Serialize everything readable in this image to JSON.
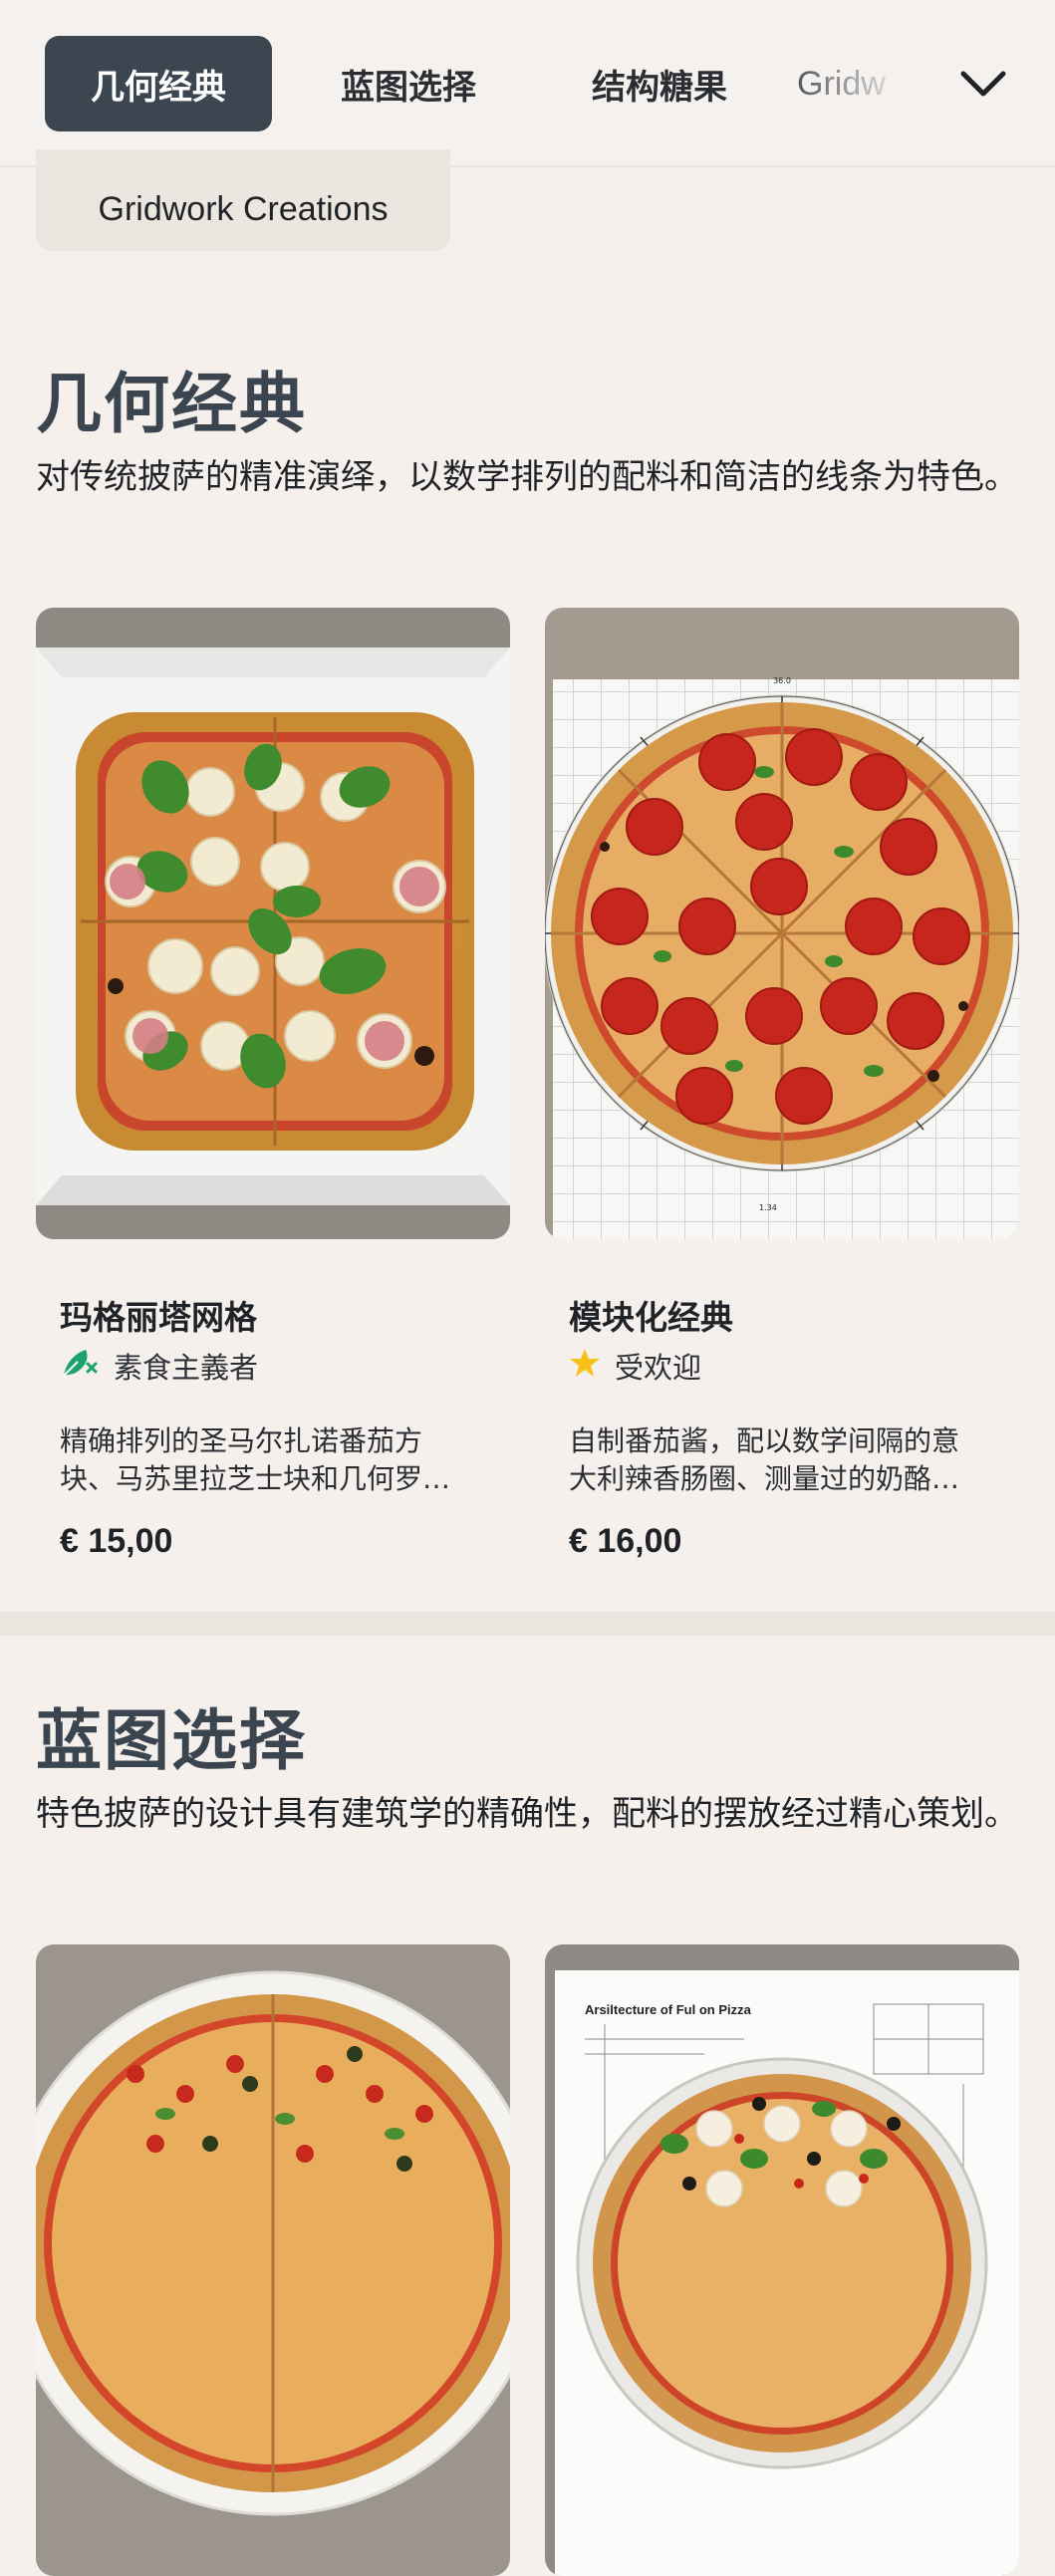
{
  "tabs": [
    {
      "label": "几何经典",
      "active": true
    },
    {
      "label": "蓝图选择",
      "active": false
    },
    {
      "label": "结构糖果",
      "active": false
    },
    {
      "label": "Gridw",
      "active": false
    }
  ],
  "chip_label": "Gridwork Creations",
  "sections": [
    {
      "title": "几何经典",
      "desc": "对传统披萨的精准演绎，以数学排列的配料和简洁的线条为特色。",
      "items": [
        {
          "name": "玛格丽塔网格",
          "tag": "素食主義者",
          "tag_icon": "vegetable-leaf-icon",
          "desc_line1": "精确排列的圣马尔扎诺番茄方",
          "desc_line2": "块、马苏里拉芝士块和几何罗…",
          "price": "€ 15,00"
        },
        {
          "name": "模块化经典",
          "tag": "受欢迎",
          "tag_icon": "star-icon",
          "desc_line1": "自制番茄酱，配以数学间隔的意",
          "desc_line2": "大利辣香肠圈、测量过的奶酪…",
          "price": "€ 16,00"
        }
      ]
    },
    {
      "title": "蓝图选择",
      "desc": "特色披萨的设计具有建筑学的精确性，配料的摆放经过精心策划。",
      "image_texts": [
        "Arsiltecture of Ful on Pizza"
      ]
    }
  ],
  "image_marks": {
    "ruler_top": "36.0",
    "ruler_bottom": "1.34"
  },
  "colors": {
    "active_tab": "#3b4651",
    "background": "#f5f0ec",
    "veg_green": "#1aa36a",
    "star_yellow": "#f6c21a"
  }
}
